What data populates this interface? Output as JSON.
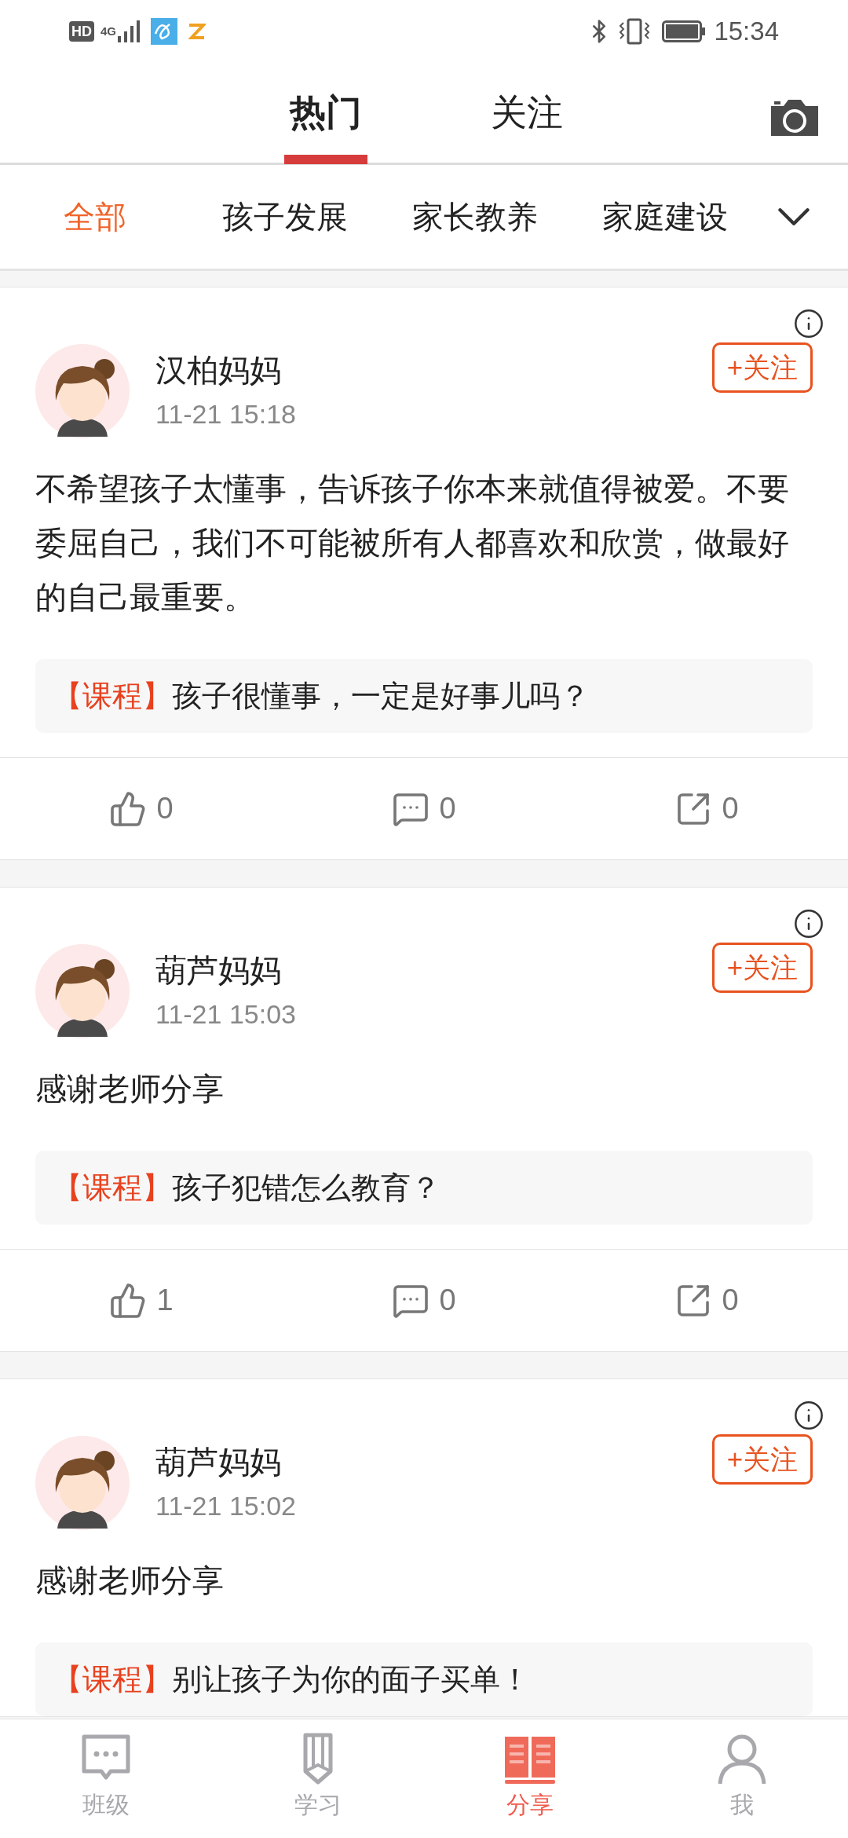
{
  "status_bar": {
    "hd": "HD",
    "network": "4G",
    "time": "15:34"
  },
  "tabs": [
    {
      "label": "热门",
      "selected": true
    },
    {
      "label": "关注",
      "selected": false
    }
  ],
  "categories": [
    {
      "label": "全部",
      "selected": true
    },
    {
      "label": "孩子发展",
      "selected": false
    },
    {
      "label": "家长教养",
      "selected": false
    },
    {
      "label": "家庭建设",
      "selected": false
    }
  ],
  "posts": [
    {
      "author": "汉柏妈妈",
      "time": "11-21 15:18",
      "follow": "+关注",
      "text": "不希望孩子太懂事，告诉孩子你本来就值得被爱。不要委屈自己，我们不可能被所有人都喜欢和欣赏，做最好的自己最重要。",
      "course_tag": "【课程】",
      "course_title": "孩子很懂事，一定是好事儿吗？",
      "likes": "0",
      "comments": "0",
      "shares": "0"
    },
    {
      "author": "葫芦妈妈",
      "time": "11-21 15:03",
      "follow": "+关注",
      "text": "感谢老师分享",
      "course_tag": "【课程】",
      "course_title": "孩子犯错怎么教育？",
      "likes": "1",
      "comments": "0",
      "shares": "0"
    },
    {
      "author": "葫芦妈妈",
      "time": "11-21 15:02",
      "follow": "+关注",
      "text": "感谢老师分享",
      "course_tag": "【课程】",
      "course_title": "别让孩子为你的面子买单！"
    }
  ],
  "bottom_nav": [
    {
      "label": "班级",
      "selected": false
    },
    {
      "label": "学习",
      "selected": false
    },
    {
      "label": "分享",
      "selected": true
    },
    {
      "label": "我",
      "selected": false
    }
  ]
}
